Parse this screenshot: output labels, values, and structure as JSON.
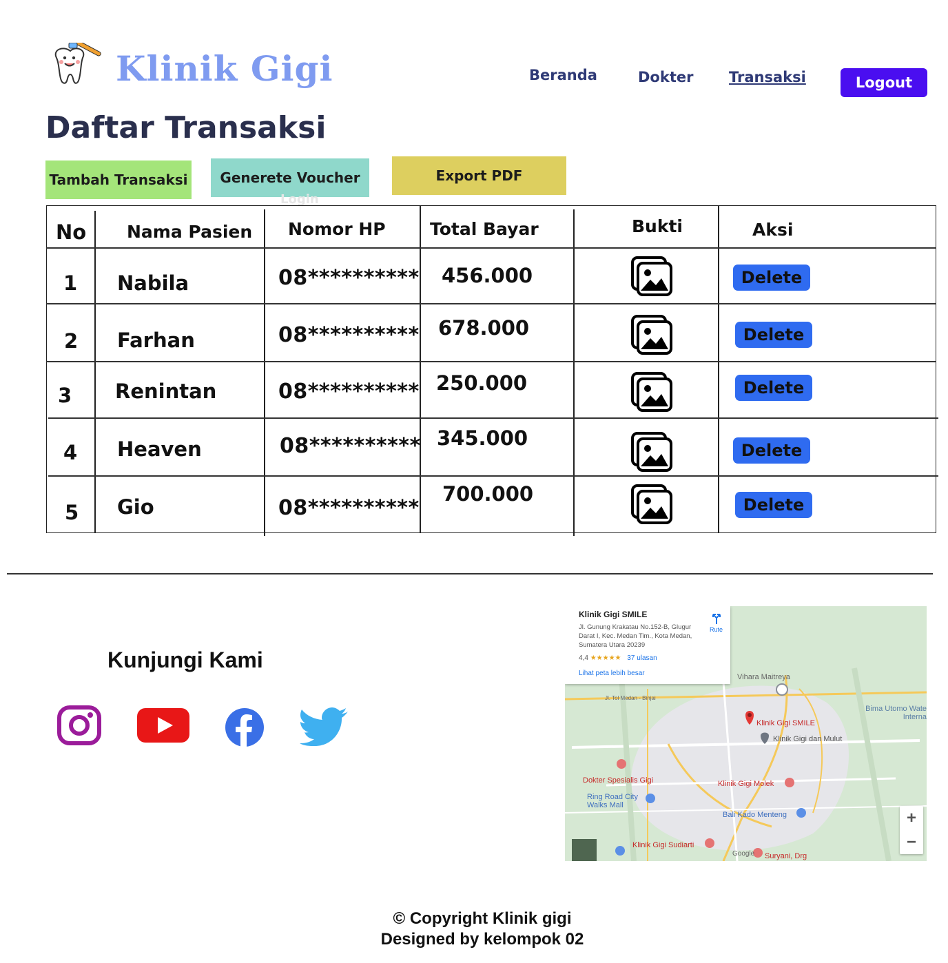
{
  "header": {
    "brand": "Klinik Gigi",
    "nav": [
      {
        "label": "Beranda",
        "active": false
      },
      {
        "label": "Dokter",
        "active": false
      },
      {
        "label": "Transaksi",
        "active": true
      }
    ],
    "logout_label": "Logout"
  },
  "page": {
    "title": "Daftar Transaksi",
    "actions": {
      "add_label": "Tambah Transaksi",
      "voucher_label": "Generete Voucher",
      "export_label": "Export PDF"
    },
    "ghost_text": "Login"
  },
  "table": {
    "headers": {
      "no": "No",
      "name": "Nama Pasien",
      "phone": "Nomor HP",
      "total": "Total Bayar",
      "proof": "Bukti",
      "action": "Aksi"
    },
    "rows": [
      {
        "no": "1",
        "name": "Nabila",
        "phone": "08**********",
        "total": "456.000",
        "delete_label": "Delete"
      },
      {
        "no": "2",
        "name": "Farhan",
        "phone": "08**********",
        "total": "678.000",
        "delete_label": "Delete"
      },
      {
        "no": "3",
        "name": "Renintan",
        "phone": "08**********",
        "total": "250.000",
        "delete_label": "Delete"
      },
      {
        "no": "4",
        "name": "Heaven",
        "phone": "08**********",
        "total": "345.000",
        "delete_label": "Delete"
      },
      {
        "no": "5",
        "name": "Gio",
        "phone": "08**********",
        "total": "700.000",
        "delete_label": "Delete"
      }
    ]
  },
  "footer": {
    "visit_title": "Kunjungi Kami",
    "social_icons": [
      "instagram-icon",
      "youtube-icon",
      "facebook-icon",
      "twitter-icon"
    ],
    "copyright": "© Copyright Klinik gigi",
    "designed_by": "Designed by kelompok 02"
  },
  "map": {
    "place_name": "Klinik Gigi SMILE",
    "address": "Jl. Gunung Krakatau No.152-B, Glugur Darat I, Kec. Medan Tim., Kota Medan, Sumatera Utara 20239",
    "rating": "4,4",
    "stars": "★★★★★",
    "reviews": "37 ulasan",
    "larger_map_link": "Lihat peta lebih besar",
    "route_label": "Rute",
    "labels": [
      "Vihara Maitreya",
      "Bima Utomo Wate Interna",
      "Jl. Tol Medan - Binjai",
      "Klinik Gigi SMILE",
      "Klinik Gigi dan Mulut",
      "Dokter Spesialis Gigi",
      "Klinik Gigi Molek",
      "Ring Road City Walks Mall",
      "Bali Kado Menteng",
      "Klinik Gigi Sudiarti",
      "Suryani, Drg",
      "Google"
    ],
    "zoom_in": "+",
    "zoom_out": "−"
  },
  "colors": {
    "brand": "#7f9bf0",
    "nav": "#2f3a76",
    "logout": "#4a0ef0",
    "add_btn": "#a4e57a",
    "voucher_btn": "#8fd8cb",
    "export_btn": "#ddcf5f",
    "delete_btn": "#2f6bf0"
  }
}
